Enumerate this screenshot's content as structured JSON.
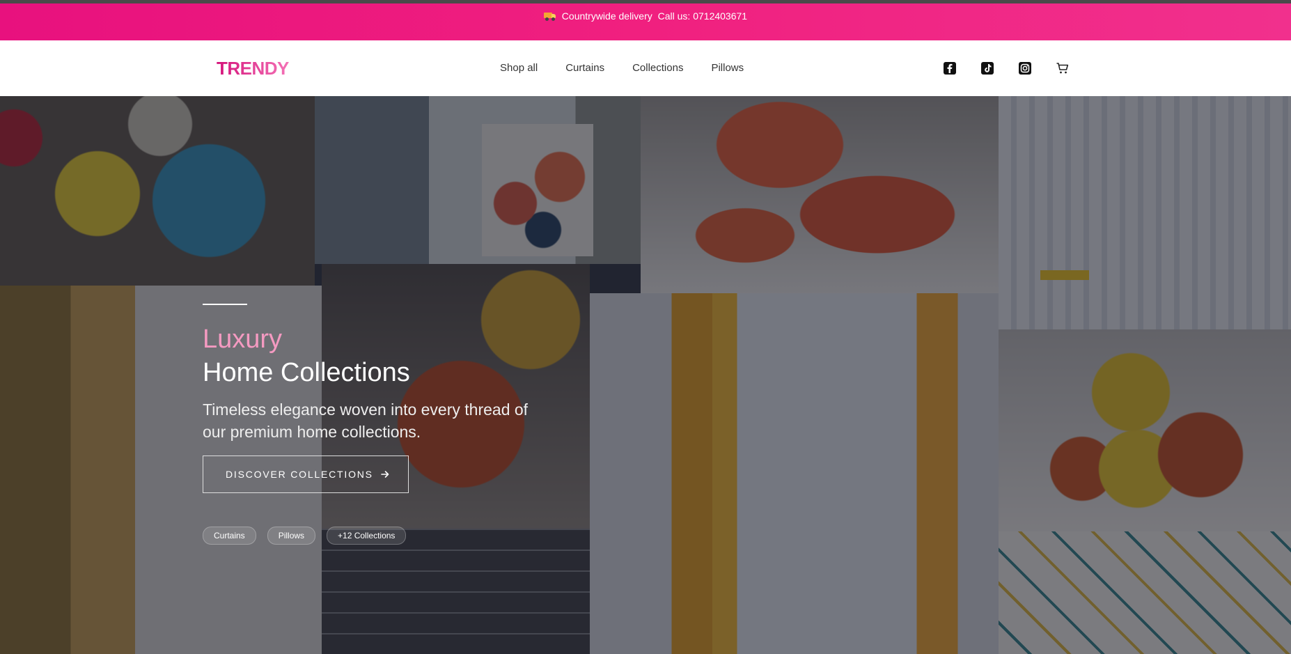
{
  "promo": {
    "delivery": "Countrywide delivery",
    "call": "Call us: 0712403671"
  },
  "header": {
    "logo": "TRENDY",
    "nav": [
      "Shop all",
      "Curtains",
      "Collections",
      "Pillows"
    ],
    "icons": [
      "facebook-icon",
      "tiktok-icon",
      "instagram-icon",
      "cart-icon"
    ]
  },
  "hero": {
    "title_accent": "Luxury",
    "title_main": "Home Collections",
    "subtitle": "Timeless elegance woven into every thread of our premium home collections.",
    "cta_label": "DISCOVER COLLECTIONS",
    "tags": [
      "Curtains",
      "Pillows",
      "+12 Collections"
    ]
  },
  "colors": {
    "brand_pink": "#e8117e",
    "accent_pink": "#f49ac1"
  }
}
